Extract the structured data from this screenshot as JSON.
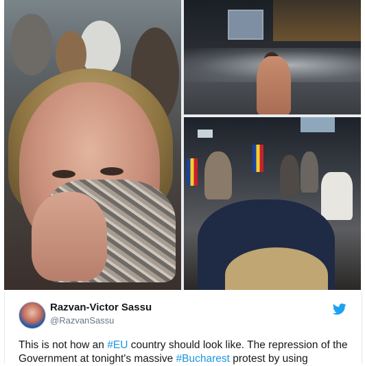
{
  "tweet": {
    "display_name": "Razvan-Victor Sassu",
    "handle": "@RazvanSassu",
    "text_part1": "This is not how an ",
    "hashtag1": "#EU",
    "text_part2": " country should look like. The repression of the Government at tonight's massive ",
    "hashtag2": "#Bucharest",
    "text_part3": " protest by using"
  },
  "icons": {
    "bird": "twitter-bird-icon"
  },
  "colors": {
    "hashtag": "#1b95e0",
    "twitter_blue": "#1da1f2",
    "text": "#14171a",
    "secondary_text": "#657786"
  }
}
